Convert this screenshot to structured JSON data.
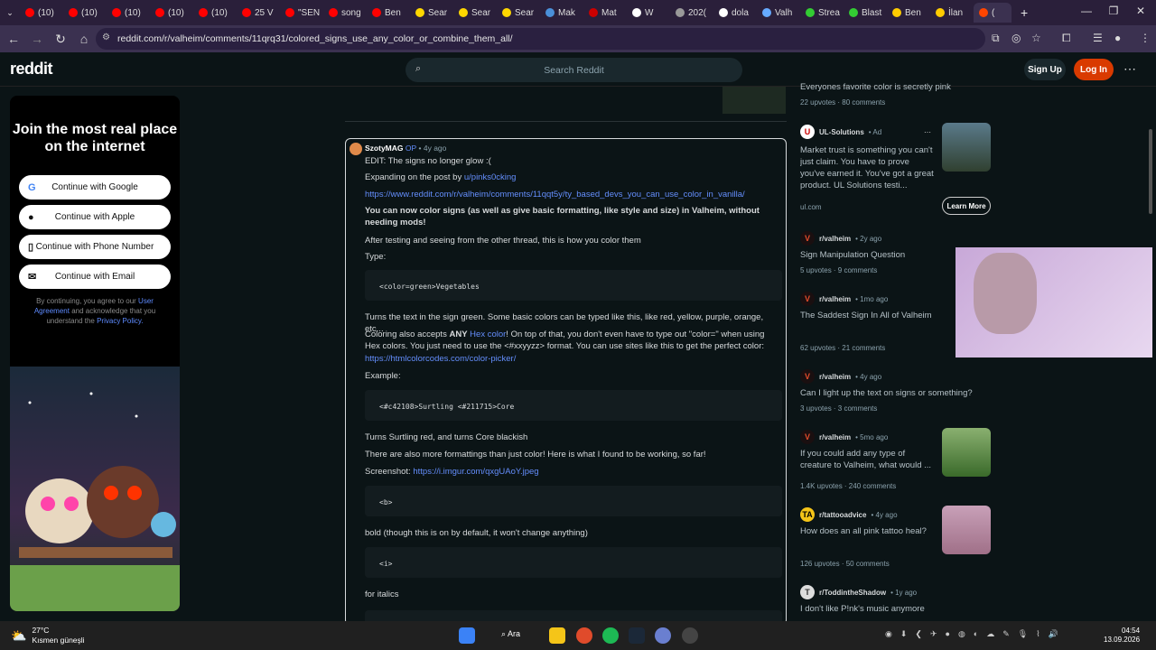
{
  "browser": {
    "tabs": [
      {
        "label": "(10)",
        "color": "#ff0000"
      },
      {
        "label": "(10)",
        "color": "#ff0000"
      },
      {
        "label": "(10)",
        "color": "#ff0000"
      },
      {
        "label": "(10)",
        "color": "#ff0000"
      },
      {
        "label": "(10)",
        "color": "#ff0000"
      },
      {
        "label": "25 V",
        "color": "#ff0000"
      },
      {
        "label": "\"SEN",
        "color": "#ff0000"
      },
      {
        "label": "song",
        "color": "#ff0000"
      },
      {
        "label": "Ben",
        "color": "#ff0000"
      },
      {
        "label": "Sear",
        "color": "#ffd700"
      },
      {
        "label": "Sear",
        "color": "#ffd700"
      },
      {
        "label": "Sear",
        "color": "#ffd700"
      },
      {
        "label": "Mak",
        "color": "#4a90d9"
      },
      {
        "label": "Mat",
        "color": "#cc0000"
      },
      {
        "label": "W",
        "color": "#ffffff"
      },
      {
        "label": "202(",
        "color": "#999999"
      },
      {
        "label": "dola",
        "color": "#ffffff"
      },
      {
        "label": "Valh",
        "color": "#66aaff"
      },
      {
        "label": "Strea",
        "color": "#33cc33"
      },
      {
        "label": "Blast",
        "color": "#33cc33"
      },
      {
        "label": "Ben",
        "color": "#ffcc00"
      },
      {
        "label": "İlan",
        "color": "#ffcc00"
      },
      {
        "label": "(",
        "color": "#ff4500"
      }
    ],
    "url": "reddit.com/r/valheim/comments/11qrq31/colored_signs_use_any_color_or_combine_them_all/"
  },
  "header": {
    "logo": "reddit",
    "search_placeholder": "Search Reddit",
    "signup": "Sign Up",
    "login": "Log In"
  },
  "join": {
    "title": "Join the most real place on the internet",
    "buttons": [
      {
        "label": "Continue with Google",
        "icon": "G"
      },
      {
        "label": "Continue with Apple",
        "icon": ""
      },
      {
        "label": "Continue with Phone Number",
        "icon": "▯"
      },
      {
        "label": "Continue with Email",
        "icon": "✉"
      }
    ],
    "legal_pre": "By continuing, you agree to our",
    "legal_link1": "User Agreement",
    "legal_mid": "and acknowledge that you understand the",
    "legal_link2": "Privacy Policy."
  },
  "post": {
    "author": "SzotyMAG",
    "op": "OP",
    "age": "• 4y ago",
    "edit": "EDIT: The signs no longer glow :(",
    "expanding": "Expanding on the post by ",
    "expanding_link": "u/pinks0cking",
    "link1": "https://www.reddit.com/r/valheim/comments/11qqt5y/ty_based_devs_you_can_use_color_in_vanilla/",
    "bold_line": "You can now color signs (as well as give basic formatting, like style and size) in Valheim, without needing mods!",
    "after": "After testing and seeing from the other thread, this is how you color them",
    "type": "Type:",
    "code1": "<color=green>Vegetables",
    "turns": "Turns the text in the sign green. Some basic colors can be typed like this, like red, yellow, purple, orange, etc...",
    "coloring_a": "Coloring also accepts ",
    "coloring_any": "ANY",
    "coloring_link": "Hex color",
    "coloring_b": "! On top of that, you don't even have to type out \"color=\" when using Hex colors. You just need to use the <#xxyyzz> format. You can use sites like this to get the perfect color:",
    "link2": "https://htmlcolorcodes.com/color-picker/",
    "example": "Example:",
    "code2": "<#c42108>Surtling <#211715>Core",
    "turns2": "Turns Surtling red, and turns Core blackish",
    "more": "There are also more formattings than just color! Here is what I found to be working, so far!",
    "screenshot": "Screenshot: ",
    "link3": "https://i.imgur.com/qxgUAoY.jpeg",
    "code3": "<b>",
    "bold_note": "bold (though this is on by default, it won't change anything)",
    "code4": "<i>",
    "italics": "for italics"
  },
  "feed": {
    "top_title": "Everyones favorite color is secretly pink",
    "top_stats": "22 upvotes · 80 comments",
    "ad": {
      "name": "UL-Solutions",
      "tag": "• Ad",
      "text": "Market trust is something you can't just claim. You have to prove you've earned it. You've got a great product. UL Solutions testi...",
      "domain": "ul.com",
      "cta": "Learn More"
    },
    "items": [
      {
        "sub": "r/valheim",
        "age": "• 2y ago",
        "title": "Sign Manipulation Question",
        "stats": "5 upvotes · 9 comments"
      },
      {
        "sub": "r/valheim",
        "age": "• 1mo ago",
        "title": "The Saddest Sign In All of Valheim",
        "stats": "62 upvotes · 21 comments"
      },
      {
        "sub": "r/valheim",
        "age": "• 4y ago",
        "title": "Can I light up the text on signs or something?",
        "stats": "3 upvotes · 3 comments"
      },
      {
        "sub": "r/valheim",
        "age": "• 5mo ago",
        "title": "If you could add any type of creature to Valheim, what would ...",
        "stats": "1.4K upvotes · 240 comments"
      },
      {
        "sub": "r/tattooadvice",
        "age": "• 4y ago",
        "title": "How does an all pink tattoo heal?",
        "stats": "126 upvotes · 50 comments"
      },
      {
        "sub": "r/ToddintheShadow",
        "age": "• 1y ago",
        "title": "I don't like P!nk's music anymore",
        "stats": ""
      }
    ]
  },
  "taskbar": {
    "temp": "27°C",
    "weather": "Kısmen güneşli",
    "search": "Ara",
    "time": "04:54",
    "date": "13.09.2026"
  }
}
